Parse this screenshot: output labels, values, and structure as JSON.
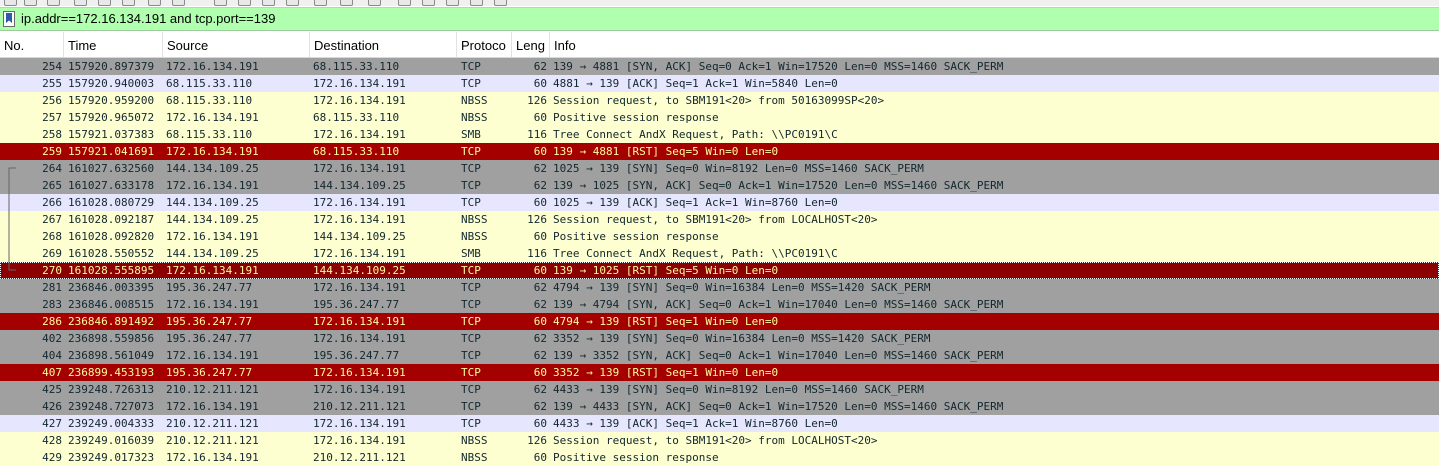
{
  "filter": {
    "value": "ip.addr==172.16.134.191 and tcp.port==139"
  },
  "columns": [
    {
      "label": "No."
    },
    {
      "label": "Time"
    },
    {
      "label": "Source"
    },
    {
      "label": "Destination"
    },
    {
      "label": "Protoco"
    },
    {
      "label": "Leng"
    },
    {
      "label": "Info"
    }
  ],
  "colors": {
    "tcp_gray": "#a0a0a0",
    "tcp_lav": "#e7e6ff",
    "smb_yellow": "#feffd0",
    "rst_red": "#a40000",
    "filter_green": "#afffaf"
  },
  "packets": [
    {
      "no": "254",
      "time": "157920.897379",
      "src": "172.16.134.191",
      "dst": "68.115.33.110",
      "proto": "TCP",
      "len": "62",
      "info": "139 → 4881 [SYN, ACK] Seq=0 Ack=1 Win=17520 Len=0 MSS=1460 SACK_PERM",
      "style": "gray"
    },
    {
      "no": "255",
      "time": "157920.940003",
      "src": "68.115.33.110",
      "dst": "172.16.134.191",
      "proto": "TCP",
      "len": "60",
      "info": "4881 → 139 [ACK] Seq=1 Ack=1 Win=5840 Len=0",
      "style": "lav"
    },
    {
      "no": "256",
      "time": "157920.959200",
      "src": "68.115.33.110",
      "dst": "172.16.134.191",
      "proto": "NBSS",
      "len": "126",
      "info": "Session request, to SBM191<20> from 50163099SP<20>",
      "style": "yellow"
    },
    {
      "no": "257",
      "time": "157920.965072",
      "src": "172.16.134.191",
      "dst": "68.115.33.110",
      "proto": "NBSS",
      "len": "60",
      "info": "Positive session response",
      "style": "yellow"
    },
    {
      "no": "258",
      "time": "157921.037383",
      "src": "68.115.33.110",
      "dst": "172.16.134.191",
      "proto": "SMB",
      "len": "116",
      "info": "Tree Connect AndX Request, Path: \\\\PC0191\\C",
      "style": "yellow"
    },
    {
      "no": "259",
      "time": "157921.041691",
      "src": "172.16.134.191",
      "dst": "68.115.33.110",
      "proto": "TCP",
      "len": "60",
      "info": "139 → 4881 [RST] Seq=5 Win=0 Len=0",
      "style": "red"
    },
    {
      "no": "264",
      "time": "161027.632560",
      "src": "144.134.109.25",
      "dst": "172.16.134.191",
      "proto": "TCP",
      "len": "62",
      "info": "1025 → 139 [SYN] Seq=0 Win=8192 Len=0 MSS=1460 SACK_PERM",
      "style": "gray"
    },
    {
      "no": "265",
      "time": "161027.633178",
      "src": "172.16.134.191",
      "dst": "144.134.109.25",
      "proto": "TCP",
      "len": "62",
      "info": "139 → 1025 [SYN, ACK] Seq=0 Ack=1 Win=17520 Len=0 MSS=1460 SACK_PERM",
      "style": "gray"
    },
    {
      "no": "266",
      "time": "161028.080729",
      "src": "144.134.109.25",
      "dst": "172.16.134.191",
      "proto": "TCP",
      "len": "60",
      "info": "1025 → 139 [ACK] Seq=1 Ack=1 Win=8760 Len=0",
      "style": "lav"
    },
    {
      "no": "267",
      "time": "161028.092187",
      "src": "144.134.109.25",
      "dst": "172.16.134.191",
      "proto": "NBSS",
      "len": "126",
      "info": "Session request, to SBM191<20> from LOCALHOST<20>",
      "style": "yellow"
    },
    {
      "no": "268",
      "time": "161028.092820",
      "src": "172.16.134.191",
      "dst": "144.134.109.25",
      "proto": "NBSS",
      "len": "60",
      "info": "Positive session response",
      "style": "yellow"
    },
    {
      "no": "269",
      "time": "161028.550552",
      "src": "144.134.109.25",
      "dst": "172.16.134.191",
      "proto": "SMB",
      "len": "116",
      "info": "Tree Connect AndX Request, Path: \\\\PC0191\\C",
      "style": "yellow"
    },
    {
      "no": "270",
      "time": "161028.555895",
      "src": "172.16.134.191",
      "dst": "144.134.109.25",
      "proto": "TCP",
      "len": "60",
      "info": "139 → 1025 [RST] Seq=5 Win=0 Len=0",
      "style": "selected"
    },
    {
      "no": "281",
      "time": "236846.003395",
      "src": "195.36.247.77",
      "dst": "172.16.134.191",
      "proto": "TCP",
      "len": "62",
      "info": "4794 → 139 [SYN] Seq=0 Win=16384 Len=0 MSS=1420 SACK_PERM",
      "style": "gray"
    },
    {
      "no": "283",
      "time": "236846.008515",
      "src": "172.16.134.191",
      "dst": "195.36.247.77",
      "proto": "TCP",
      "len": "62",
      "info": "139 → 4794 [SYN, ACK] Seq=0 Ack=1 Win=17040 Len=0 MSS=1460 SACK_PERM",
      "style": "gray"
    },
    {
      "no": "286",
      "time": "236846.891492",
      "src": "195.36.247.77",
      "dst": "172.16.134.191",
      "proto": "TCP",
      "len": "60",
      "info": "4794 → 139 [RST] Seq=1 Win=0 Len=0",
      "style": "red"
    },
    {
      "no": "402",
      "time": "236898.559856",
      "src": "195.36.247.77",
      "dst": "172.16.134.191",
      "proto": "TCP",
      "len": "62",
      "info": "3352 → 139 [SYN] Seq=0 Win=16384 Len=0 MSS=1420 SACK_PERM",
      "style": "gray"
    },
    {
      "no": "404",
      "time": "236898.561049",
      "src": "172.16.134.191",
      "dst": "195.36.247.77",
      "proto": "TCP",
      "len": "62",
      "info": "139 → 3352 [SYN, ACK] Seq=0 Ack=1 Win=17040 Len=0 MSS=1460 SACK_PERM",
      "style": "gray"
    },
    {
      "no": "407",
      "time": "236899.453193",
      "src": "195.36.247.77",
      "dst": "172.16.134.191",
      "proto": "TCP",
      "len": "60",
      "info": "3352 → 139 [RST] Seq=1 Win=0 Len=0",
      "style": "red"
    },
    {
      "no": "425",
      "time": "239248.726313",
      "src": "210.12.211.121",
      "dst": "172.16.134.191",
      "proto": "TCP",
      "len": "62",
      "info": "4433 → 139 [SYN] Seq=0 Win=8192 Len=0 MSS=1460 SACK_PERM",
      "style": "gray"
    },
    {
      "no": "426",
      "time": "239248.727073",
      "src": "172.16.134.191",
      "dst": "210.12.211.121",
      "proto": "TCP",
      "len": "62",
      "info": "139 → 4433 [SYN, ACK] Seq=0 Ack=1 Win=17520 Len=0 MSS=1460 SACK_PERM",
      "style": "gray"
    },
    {
      "no": "427",
      "time": "239249.004333",
      "src": "210.12.211.121",
      "dst": "172.16.134.191",
      "proto": "TCP",
      "len": "60",
      "info": "4433 → 139 [ACK] Seq=1 Ack=1 Win=8760 Len=0",
      "style": "lav"
    },
    {
      "no": "428",
      "time": "239249.016039",
      "src": "210.12.211.121",
      "dst": "172.16.134.191",
      "proto": "NBSS",
      "len": "126",
      "info": "Session request, to SBM191<20> from LOCALHOST<20>",
      "style": "yellow"
    },
    {
      "no": "429",
      "time": "239249.017323",
      "src": "172.16.134.191",
      "dst": "210.12.211.121",
      "proto": "NBSS",
      "len": "60",
      "info": "Positive session response",
      "style": "yellow"
    }
  ]
}
